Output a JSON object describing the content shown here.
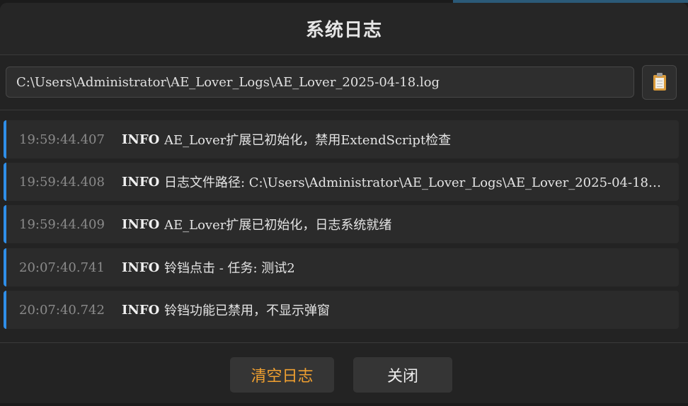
{
  "dialog": {
    "title": "系统日志"
  },
  "path": {
    "value": "C:\\Users\\Administrator\\AE_Lover_Logs\\AE_Lover_2025-04-18.log",
    "copy_icon": "clipboard-icon"
  },
  "logs": [
    {
      "time": "19:59:44.407",
      "level": "INFO",
      "message": "AE_Lover扩展已初始化，禁用ExtendScript检查"
    },
    {
      "time": "19:59:44.408",
      "level": "INFO",
      "message": "日志文件路径: C:\\Users\\Administrator\\AE_Lover_Logs\\AE_Lover_2025-04-18.log"
    },
    {
      "time": "19:59:44.409",
      "level": "INFO",
      "message": "AE_Lover扩展已初始化，日志系统就绪"
    },
    {
      "time": "20:07:40.741",
      "level": "INFO",
      "message": "铃铛点击 - 任务: 测试2"
    },
    {
      "time": "20:07:40.742",
      "level": "INFO",
      "message": "铃铛功能已禁用，不显示弹窗"
    }
  ],
  "footer": {
    "clear_label": "清空日志",
    "close_label": "关闭"
  },
  "colors": {
    "accent": "#2f8ee8",
    "clear_text": "#f0a030"
  }
}
